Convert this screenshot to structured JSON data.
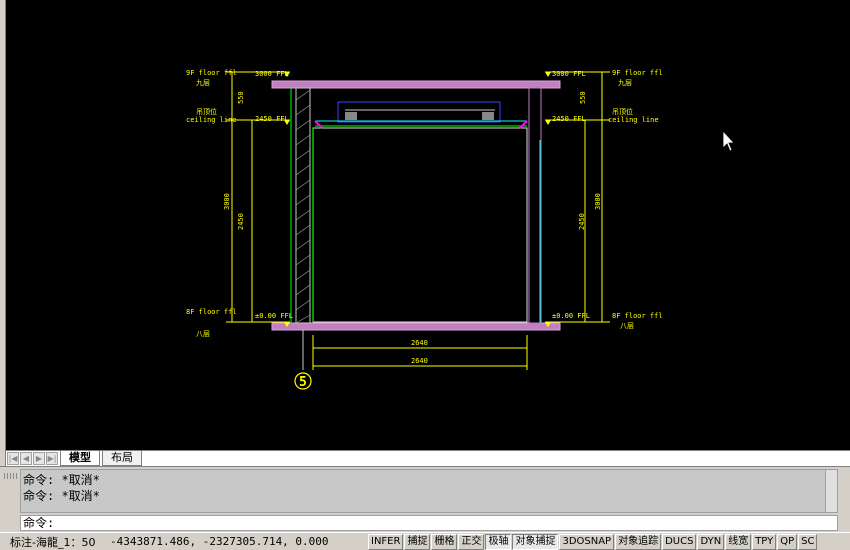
{
  "drawing": {
    "left_labels": {
      "floor_top": "9F floor ffl",
      "floor_top_cn": "九层",
      "ceiling_cn": "吊顶位",
      "ceiling_en": "ceiling line",
      "floor_bottom": "8F floor ffl",
      "floor_bottom_cn": "八层"
    },
    "right_labels": {
      "floor_top": "9F floor ffl",
      "floor_top_cn": "九层",
      "ceiling_cn": "吊顶位",
      "ceiling_en": "ceiling line",
      "floor_bottom": "8F floor ffl",
      "floor_bottom_cn": "八层"
    },
    "elevations": {
      "top_left": "3000 FFL",
      "ceiling_left": "2450 FFL",
      "bottom_left": "±0.00 FFL",
      "top_right": "3000 FFL",
      "ceiling_right": "2450 FFL",
      "bottom_right": "±0.00 FFL"
    },
    "dims": {
      "left_550": "550",
      "left_3000": "3000",
      "left_2450": "2450",
      "right_550": "550",
      "right_3000": "3000",
      "right_2450": "2450",
      "width_1": "2640",
      "width_2": "2640"
    },
    "grid_bubble": "5"
  },
  "tabs": {
    "model": "模型",
    "layout": "布局"
  },
  "command": {
    "history_1": "命令: *取消*",
    "history_2": "命令: *取消*",
    "prompt": "命令:"
  },
  "status": {
    "scale": "标注-海龍_1：50",
    "coords": "-4343871.486, -2327305.714, 0.000",
    "buttons": [
      "INFER",
      "捕捉",
      "栅格",
      "正交",
      "极轴",
      "对象捕捉",
      "3DOSNAP",
      "对象追踪",
      "DUCS",
      "DYN",
      "线宽",
      "TPY",
      "QP",
      "SC"
    ]
  },
  "colors": {
    "yellow": "#ffff00",
    "slab": "#c080c0",
    "wall": "#c8c8c8",
    "green": "#00ff00",
    "cyan": "#00ffff",
    "blue": "#4040ff",
    "magenta": "#ff00ff"
  }
}
